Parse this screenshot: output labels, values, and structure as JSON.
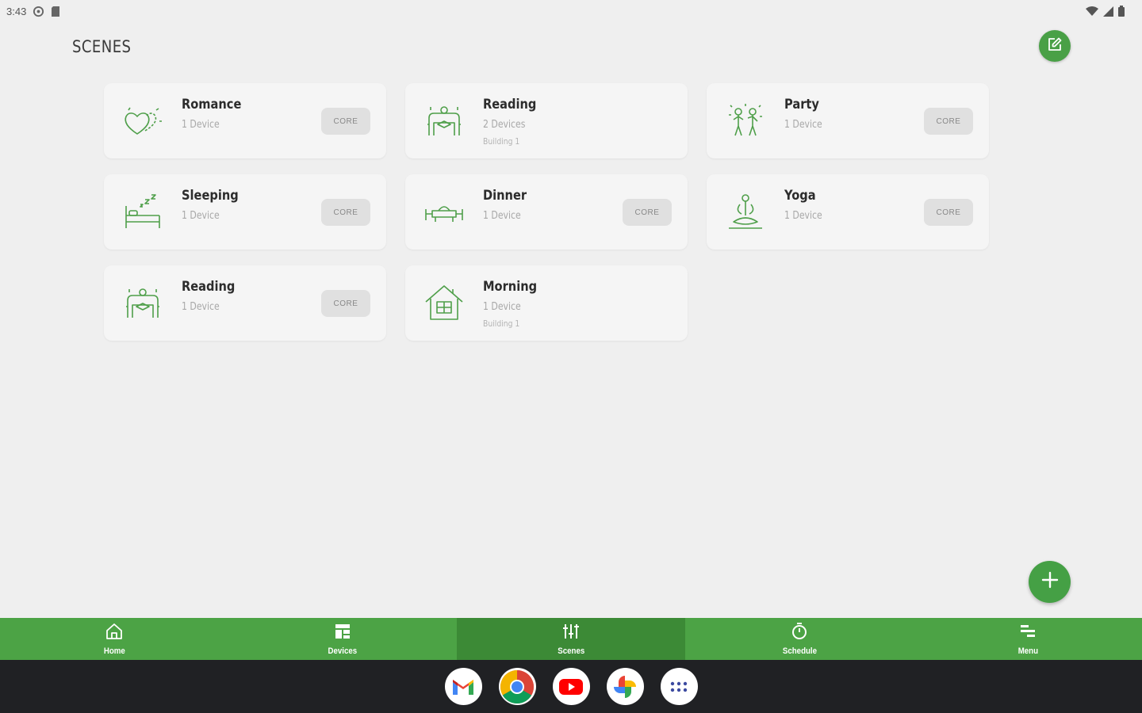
{
  "status_bar": {
    "time": "3:43",
    "icons": [
      "settings-icon",
      "sd-card-icon",
      "wifi-icon",
      "signal-icon",
      "battery-icon"
    ]
  },
  "header": {
    "title": "SCENES",
    "edit_icon": "edit-icon"
  },
  "scenes": [
    {
      "name": "Romance",
      "devices": "1 Device",
      "building": "",
      "badge": "CORE",
      "icon": "hearts-icon"
    },
    {
      "name": "Reading",
      "devices": "2 Devices",
      "building": "Building 1",
      "badge": "",
      "icon": "reading-icon"
    },
    {
      "name": "Party",
      "devices": "1 Device",
      "building": "",
      "badge": "CORE",
      "icon": "party-icon"
    },
    {
      "name": "Sleeping",
      "devices": "1 Device",
      "building": "",
      "badge": "CORE",
      "icon": "bed-icon"
    },
    {
      "name": "Dinner",
      "devices": "1 Device",
      "building": "",
      "badge": "CORE",
      "icon": "dinner-icon"
    },
    {
      "name": "Yoga",
      "devices": "1 Device",
      "building": "",
      "badge": "CORE",
      "icon": "yoga-icon"
    },
    {
      "name": "Reading",
      "devices": "1 Device",
      "building": "",
      "badge": "CORE",
      "icon": "reading-icon"
    },
    {
      "name": "Morning",
      "devices": "1 Device",
      "building": "Building 1",
      "badge": "",
      "icon": "house-icon"
    }
  ],
  "add_button": {
    "icon": "plus-icon"
  },
  "bottom_nav": [
    {
      "label": "Home",
      "icon": "home-icon",
      "active": false
    },
    {
      "label": "Devices",
      "icon": "devices-icon",
      "active": false
    },
    {
      "label": "Scenes",
      "icon": "sliders-icon",
      "active": true
    },
    {
      "label": "Schedule",
      "icon": "timer-icon",
      "active": false
    },
    {
      "label": "Menu",
      "icon": "menu-icon",
      "active": false
    }
  ],
  "taskbar": [
    {
      "name": "gmail-icon"
    },
    {
      "name": "chrome-icon"
    },
    {
      "name": "youtube-icon"
    },
    {
      "name": "photos-icon"
    },
    {
      "name": "app-drawer-icon"
    }
  ],
  "colors": {
    "accent": "#4ca345",
    "accent_active": "#3c8a36",
    "background": "#efefef",
    "card": "#f5f5f5",
    "taskbar": "#202124"
  }
}
